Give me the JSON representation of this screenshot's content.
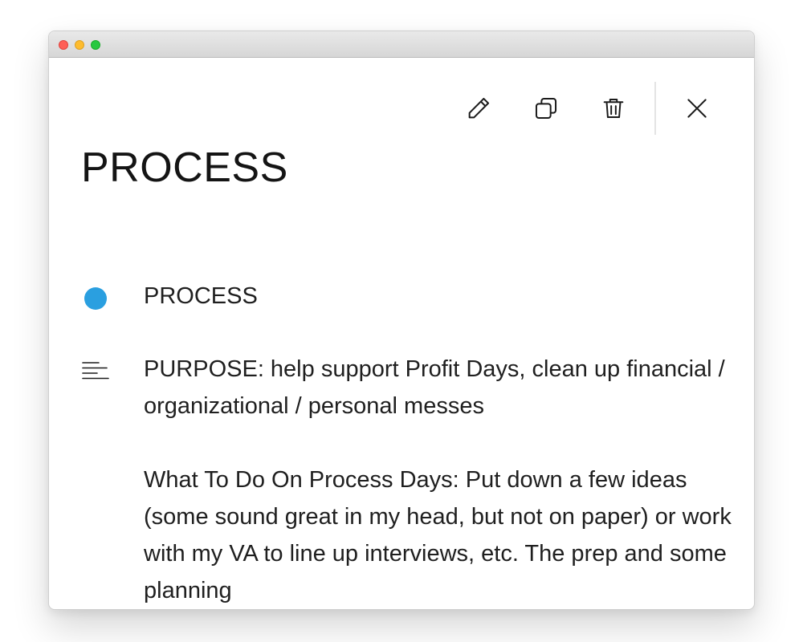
{
  "window": {
    "controls": [
      "close",
      "minimize",
      "zoom"
    ]
  },
  "toolbar": {
    "actions": [
      {
        "name": "edit",
        "icon": "pencil-icon"
      },
      {
        "name": "duplicate",
        "icon": "copy-icon"
      },
      {
        "name": "delete",
        "icon": "trash-icon"
      },
      {
        "name": "close",
        "icon": "close-icon"
      }
    ]
  },
  "record": {
    "title": "PROCESS",
    "status": {
      "label": "PROCESS",
      "color": "#2a9fe0"
    },
    "description": {
      "icon": "text-align-icon",
      "paragraphs": [
        "PURPOSE: help support Profit Days, clean up financial / organizational / personal messes",
        "What To Do On Process Days: Put down a few ideas (some sound great in my head, but not on paper) or work with my VA to line up interviews, etc. The prep and some planning"
      ]
    }
  }
}
